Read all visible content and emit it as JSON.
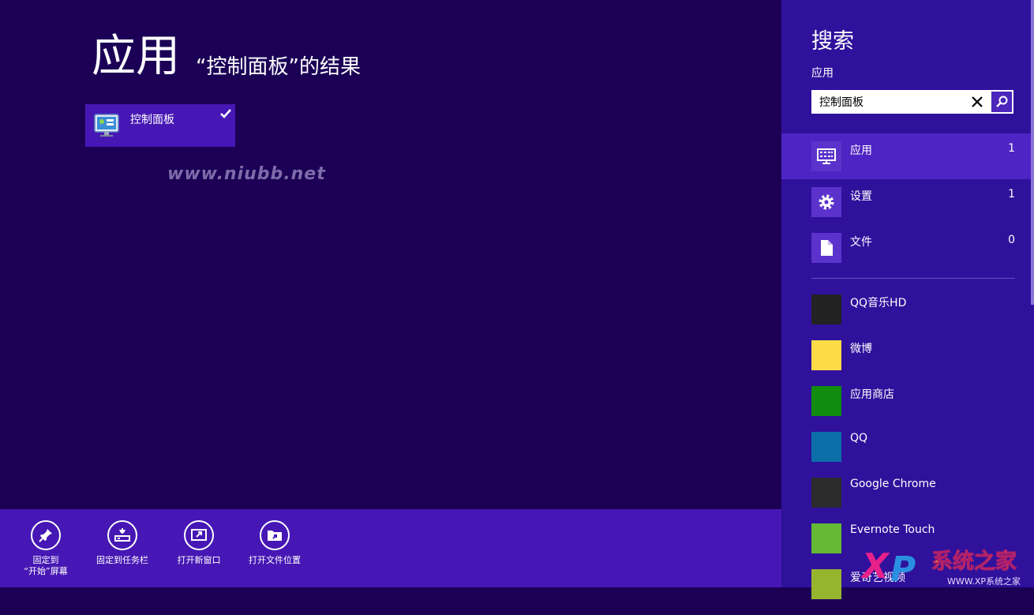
{
  "results": {
    "heading": "应用",
    "subheading": "“控制面板”的结果",
    "items": [
      {
        "label": "控制面板",
        "icon": "control-panel-icon",
        "selected": true
      }
    ]
  },
  "watermark": {
    "text": "www.niubb.net"
  },
  "app_bar": {
    "commands": [
      {
        "label": "固定到\n“开始”屏幕",
        "icon": "pin-icon"
      },
      {
        "label": "固定到任务栏",
        "icon": "taskbar-pin-icon"
      },
      {
        "label": "打开新窗口",
        "icon": "new-window-icon"
      },
      {
        "label": "打开文件位置",
        "icon": "open-folder-icon"
      }
    ]
  },
  "search_pane": {
    "title": "搜索",
    "scope": "应用",
    "query": "控制面板",
    "categories": [
      {
        "label": "应用",
        "count": "1",
        "icon": "apps-icon",
        "selected": true
      },
      {
        "label": "设置",
        "count": "1",
        "icon": "gear-icon",
        "selected": false
      },
      {
        "label": "文件",
        "count": "0",
        "icon": "file-icon",
        "selected": false
      }
    ],
    "apps": [
      {
        "label": "QQ音乐HD",
        "color": "#222222"
      },
      {
        "label": "微博",
        "color": "#fddb47"
      },
      {
        "label": "应用商店",
        "color": "#108c10"
      },
      {
        "label": "QQ",
        "color": "#0c6ea9"
      },
      {
        "label": "Google Chrome",
        "color": "#2c2c2c"
      },
      {
        "label": "Evernote Touch",
        "color": "#64b833"
      },
      {
        "label": "爱奇艺视频",
        "color": "#96b52e"
      }
    ]
  },
  "logo": {
    "text": "XP系统之家",
    "sub": "WWW.XP系统之家"
  },
  "colors": {
    "background": "#1b0056",
    "pane": "#2f119c",
    "accent": "#4617b4"
  }
}
